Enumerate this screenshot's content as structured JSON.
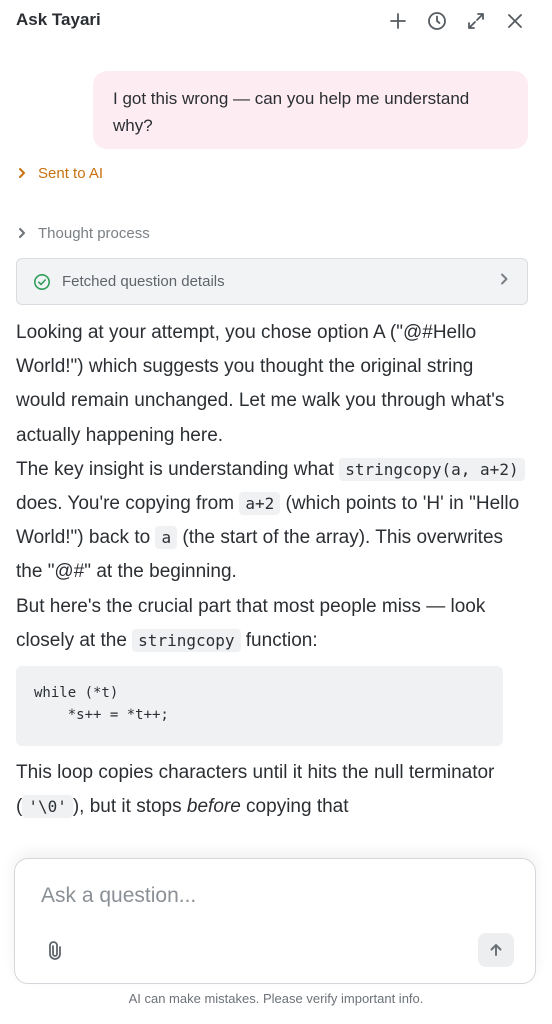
{
  "header": {
    "title": "Ask Tayari",
    "icons": [
      "plus-icon",
      "history-icon",
      "expand-icon",
      "close-icon"
    ]
  },
  "chat": {
    "user_message": "I got this wrong — can you help me understand why?",
    "sent_label": "Sent to AI",
    "thought_label": "Thought process",
    "tool_label": "Fetched question details",
    "answer": {
      "p1": "Looking at your attempt, you chose option A (\"@#Hello World!\") which suggests you thought the original string would remain unchanged. Let me walk you through what's actually happening here.",
      "p2_a": "The key insight is understanding what ",
      "p2_code1": "stringcopy(a, a+2)",
      "p2_b": " does. You're copying from ",
      "p2_code2": "a+2",
      "p2_c": " (which points to 'H' in \"Hello World!\") back to ",
      "p2_code3": "a",
      "p2_d": " (the start of the array). This overwrites the \"@#\" at the beginning.",
      "p3_a": "But here's the crucial part that most people miss — look closely at the ",
      "p3_code": "stringcopy",
      "p3_b": " function:",
      "code_block": "while (*t)\n    *s++ = *t++;",
      "p4_a": "This loop copies characters until it hits the null terminator (",
      "p4_code": "'\\0'",
      "p4_b": "), but it stops ",
      "p4_em": "before",
      "p4_c": " copying that"
    }
  },
  "composer": {
    "placeholder": "Ask a question..."
  },
  "disclaimer": "AI can make mistakes. Please verify important info.",
  "colors": {
    "user_bubble": "#fdecf2",
    "accent_orange": "#c8710f",
    "success_green": "#2f9e59"
  }
}
